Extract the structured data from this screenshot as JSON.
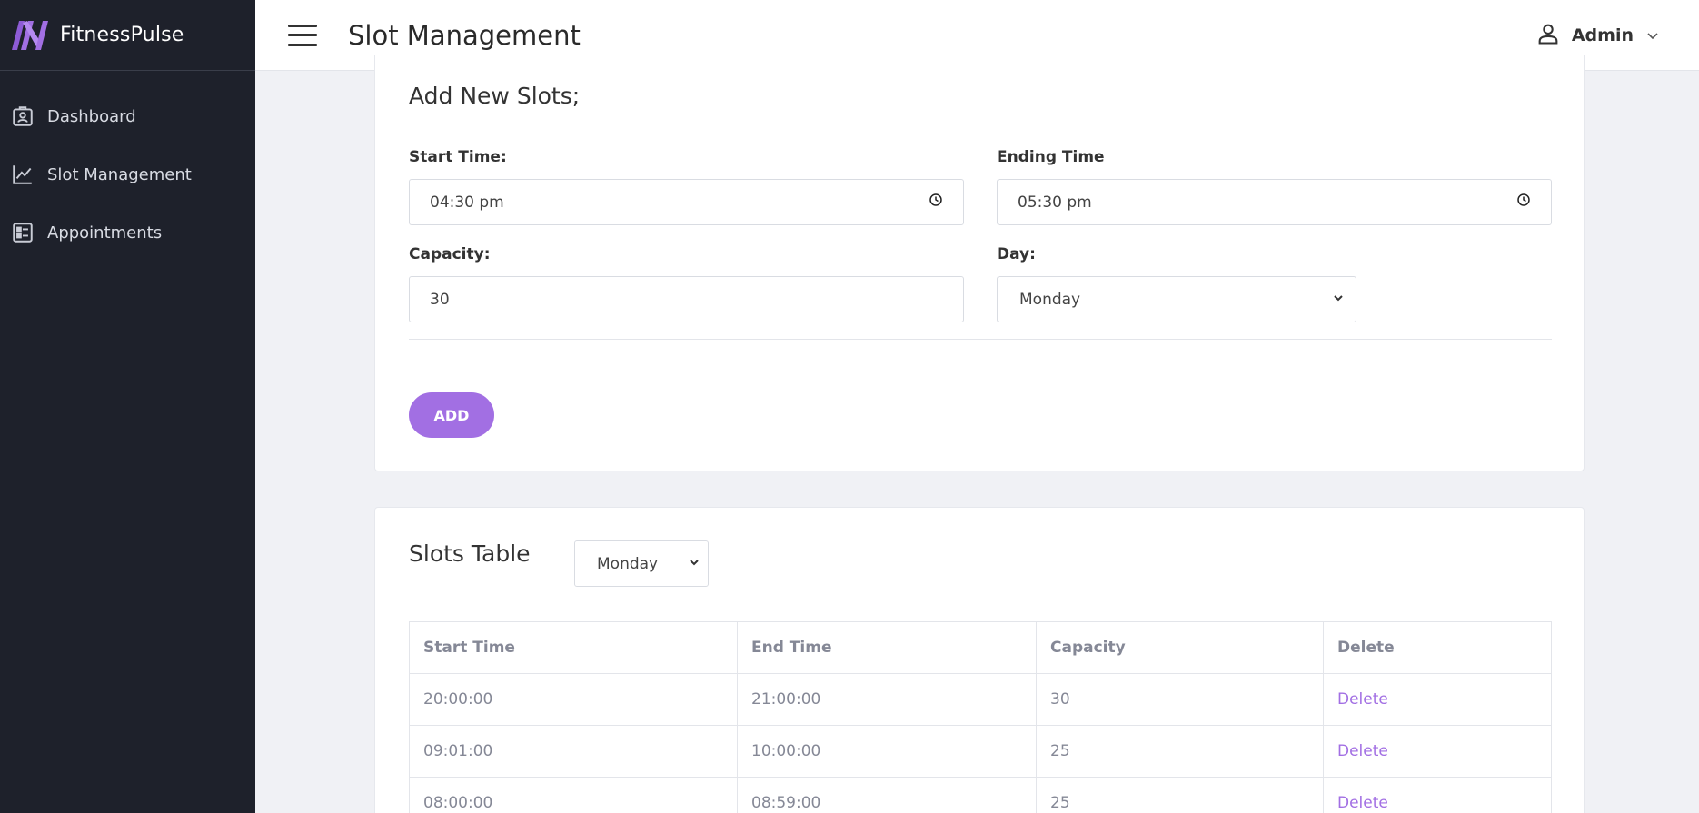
{
  "app": {
    "brand_name": "FitnessPulse"
  },
  "sidebar": {
    "items": [
      {
        "label": "Dashboard",
        "icon": "id-badge-icon"
      },
      {
        "label": "Slot Management",
        "icon": "line-chart-icon"
      },
      {
        "label": "Appointments",
        "icon": "list-card-icon"
      }
    ]
  },
  "header": {
    "title": "Slot Management",
    "user_name": "Admin"
  },
  "add_form": {
    "title": "Add New Slots;",
    "start_label": "Start Time:",
    "start_value": "04:30 pm",
    "end_label": "Ending Time",
    "end_value": "05:30 pm",
    "capacity_label": "Capacity:",
    "capacity_value": "30",
    "day_label": "Day:",
    "day_value": "Monday",
    "add_label": "ADD"
  },
  "slots_table": {
    "title": "Slots Table",
    "filter_value": "Monday",
    "columns": [
      "Start Time",
      "End Time",
      "Capacity",
      "Delete"
    ],
    "rows": [
      {
        "start": "20:00:00",
        "end": "21:00:00",
        "capacity": "30",
        "action": "Delete"
      },
      {
        "start": "09:01:00",
        "end": "10:00:00",
        "capacity": "25",
        "action": "Delete"
      },
      {
        "start": "08:00:00",
        "end": "08:59:00",
        "capacity": "25",
        "action": "Delete"
      }
    ]
  },
  "colors": {
    "accent": "#a26fe3",
    "sidebar_bg": "#1e212b",
    "page_bg": "#f0f1f5"
  }
}
